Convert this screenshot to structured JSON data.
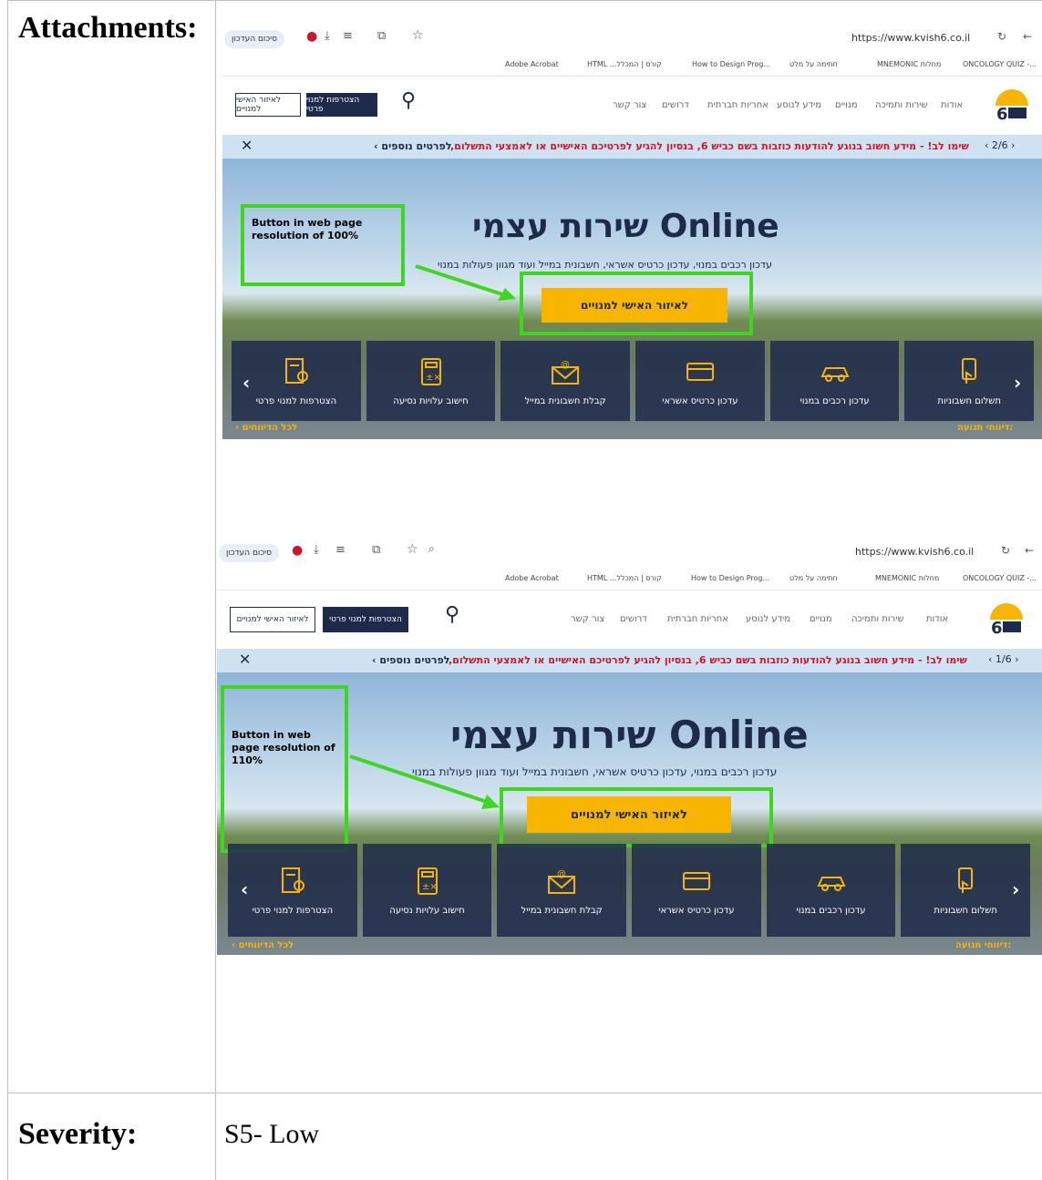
{
  "document": {
    "attachments_label": "Attachments:",
    "severity_label": "Severity:",
    "severity_value": "S5- Low"
  },
  "browser": {
    "summary_pill": "סיכום העדכון",
    "url": "https://www.kvish6.co.il",
    "bookmarks": [
      "Adobe Acrobat",
      "HTML ...קורס | המכלל",
      "How to Design Prog...",
      "חתימה על מלט",
      "MNEMONIC מחלות",
      "ONCOLOGY QUIZ -..."
    ]
  },
  "site": {
    "nav": [
      "אודות",
      "שירות ותמיכה",
      "מנויים",
      "מידע לנוסע",
      "אחריות חברתית",
      "דרושים",
      "צור קשר"
    ],
    "join_button": "הצטרפות למנוי פרטי",
    "personal_area_button": "לאיזור האישי למנויים",
    "alert_text": "שימו לב! - מידע חשוב בנוגע להודעות כוזבות בשם כביש 6, בנסיון להגיע לפרטיכם האישיים או לאמצעי התשלום,",
    "alert_more": "לפרטים נוספים ›",
    "hero_title": "שירות עצמי Online",
    "hero_subtitle": "עדכון רכבים במנוי, עדכון כרטיס אשראי, חשבונית במייל ועוד מגוון פעולות במנוי",
    "cta": "לאיזור האישי למנויים",
    "tiles": [
      "תשלום חשבוניות",
      "עדכון רכבים במנוי",
      "עדכון כרטיס אשראי",
      "קבלת חשבונית במייל",
      "חישוב עלויות נסיעה",
      "הצטרפות למנוי פרטי"
    ],
    "traffic_reports": "דיווחי תנועה:",
    "all_reports": "‹ לכל הדיווחים"
  },
  "screenshots": [
    {
      "pager": "2/6",
      "callout": "Button in web page resolution of 100%"
    },
    {
      "pager": "1/6",
      "callout": "Button in web page resolution of 110%"
    }
  ]
}
